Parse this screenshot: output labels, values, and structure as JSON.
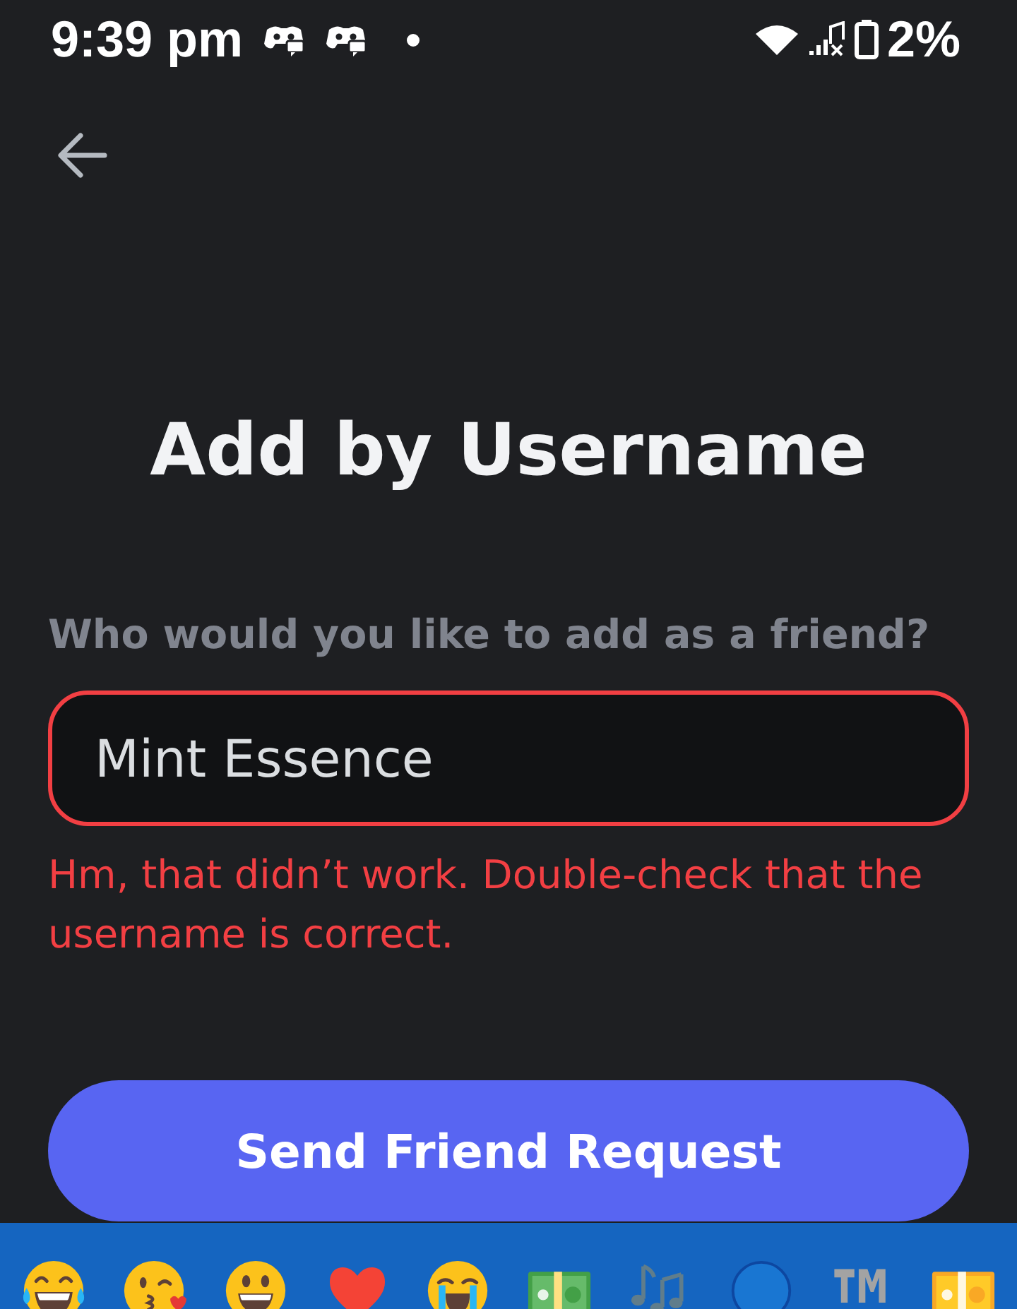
{
  "status_bar": {
    "time": "9:39 pm",
    "battery": "2%"
  },
  "title": "Add by Username",
  "field": {
    "label": "Who would you like to add as a friend?",
    "value": "Mint Essence",
    "invalid": true,
    "error": "Hm, that didn’t work. Double-check that the username is correct."
  },
  "button": {
    "label": "Send Friend Request"
  },
  "emoji_bar": {
    "symbol": "™"
  }
}
